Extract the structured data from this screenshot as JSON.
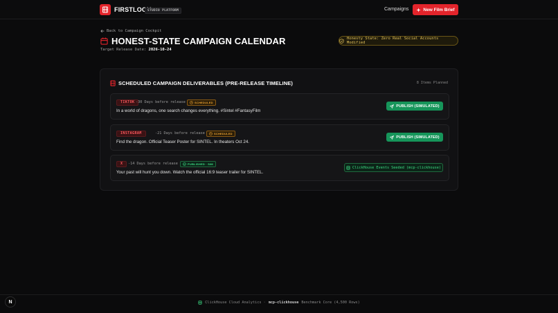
{
  "header": {
    "brand": "FIRSTLOOK",
    "studio_badge": "STUDIO PLATFORM",
    "nav_campaigns": "Campaigns",
    "new_brief_label": "New Film Brief"
  },
  "page": {
    "back_label": "Back to Campaign Cockpit",
    "title": "HONEST-STATE CAMPAIGN CALENDAR",
    "release_label": "Target Release Date:",
    "release_date": "2026-10-24",
    "honesty_badge": "Honesty State: Zero Real Social Accounts Modified"
  },
  "panel": {
    "title": "SCHEDULED CAMPAIGN DELIVERABLES (PRE-RELEASE TIMELINE)",
    "count": "8 Items Planned",
    "rows": [
      {
        "platform": "TIKTOK",
        "timing": "-30 Days before release",
        "status": "SCHEDULED",
        "caption": "In a world of dragons, one search changes everything. #Sintel #FantasyFilm",
        "action": "PUBLISH (SIMULATED)"
      },
      {
        "platform": "INSTAGRAM",
        "timing": "-21 Days before release",
        "status": "SCHEDULED",
        "caption": "Find the dragon. Official Teaser Poster for SINTEL. In theaters Oct 24.",
        "action": "PUBLISH (SIMULATED)"
      },
      {
        "platform": "X",
        "timing": "-14 Days before release",
        "status": "PUBLISHED · SIM",
        "caption": "Your past will hunt you down. Watch the official 16:9 teaser trailer for SINTEL.",
        "action": "ClickHouse Events Seeded (mcp-clickhouse)"
      }
    ]
  },
  "footer": {
    "prefix": "ClickHouse Cloud Analytics ·",
    "bold": "mcp-clickhouse",
    "suffix": "Benchmark Core (4,500 Rows)"
  },
  "corner_badge": "N",
  "colors": {
    "accent_red": "#e3242b",
    "publish_green": "#16955a",
    "scheduled_orange": "#f0a431",
    "honesty_gold": "#e2c15a"
  }
}
